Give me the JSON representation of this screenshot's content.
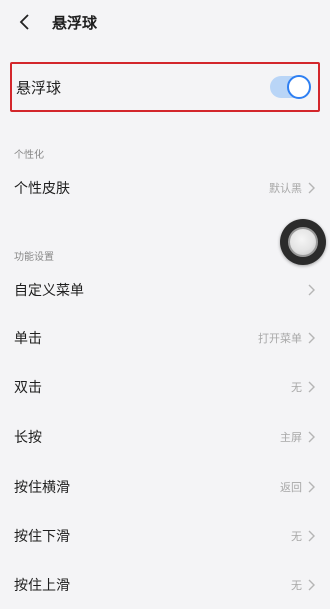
{
  "header": {
    "title": "悬浮球"
  },
  "toggle": {
    "label": "悬浮球",
    "on": true,
    "accent": "#2e7ff2"
  },
  "sections": [
    {
      "title": "个性化"
    },
    {
      "title": "功能设置"
    }
  ],
  "rows": [
    {
      "label": "个性皮肤",
      "value": "默认黑"
    },
    {
      "label": "自定义菜单",
      "value": ""
    },
    {
      "label": "单击",
      "value": "打开菜单"
    },
    {
      "label": "双击",
      "value": "无"
    },
    {
      "label": "长按",
      "value": "主屏"
    },
    {
      "label": "按住横滑",
      "value": "返回"
    },
    {
      "label": "按住下滑",
      "value": "无"
    },
    {
      "label": "按住上滑",
      "value": "无"
    }
  ]
}
